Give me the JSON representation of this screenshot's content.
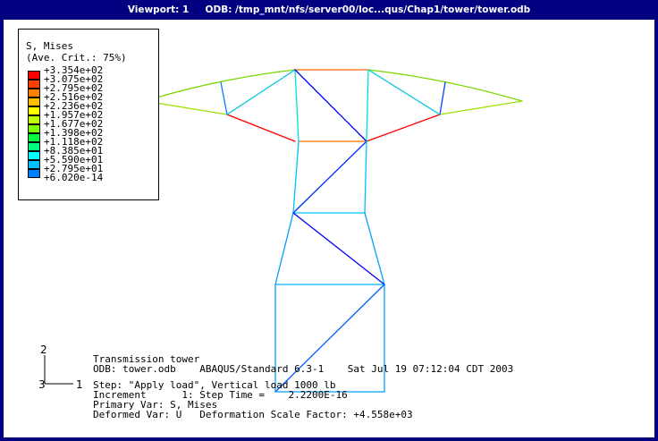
{
  "titlebar": {
    "viewport": "Viewport: 1",
    "odb": "ODB: /tmp_mnt/nfs/server00/loc...qus/Chap1/tower/tower.odb"
  },
  "legend": {
    "title": "S, Mises",
    "subtitle": "(Ave. Crit.: 75%)",
    "entries": [
      {
        "value": "+3.354e+02",
        "color": "#ff0000"
      },
      {
        "value": "+3.075e+02",
        "color": "#ff4000"
      },
      {
        "value": "+2.795e+02",
        "color": "#ff8000"
      },
      {
        "value": "+2.516e+02",
        "color": "#ffbf00"
      },
      {
        "value": "+2.236e+02",
        "color": "#ffff00"
      },
      {
        "value": "+1.957e+02",
        "color": "#bfff00"
      },
      {
        "value": "+1.677e+02",
        "color": "#80ff00"
      },
      {
        "value": "+1.398e+02",
        "color": "#00ff40"
      },
      {
        "value": "+1.118e+02",
        "color": "#00ff80"
      },
      {
        "value": "+8.385e+01",
        "color": "#00ffff"
      },
      {
        "value": "+5.590e+01",
        "color": "#00bfff"
      },
      {
        "value": "+2.795e+01",
        "color": "#0080ff"
      },
      {
        "value": "+6.020e-14",
        "color": "#0000ff"
      }
    ]
  },
  "triad": {
    "axis_y": "2",
    "axis_x": "1",
    "axis_z": "3"
  },
  "info": {
    "line1": "Transmission tower",
    "line2": "ODB: tower.odb    ABAQUS/Standard 6.3-1    Sat Jul 19 07:12:04 CDT 2003",
    "line3": "Step: \"Apply load\", Vertical load 1000 lb",
    "line4": "Increment      1: Step Time =    2.2200E-16",
    "line5": "Primary Var: S, Mises",
    "line6": "Deformed Var: U   Deformation Scale Factor: +4.558e+03"
  }
}
